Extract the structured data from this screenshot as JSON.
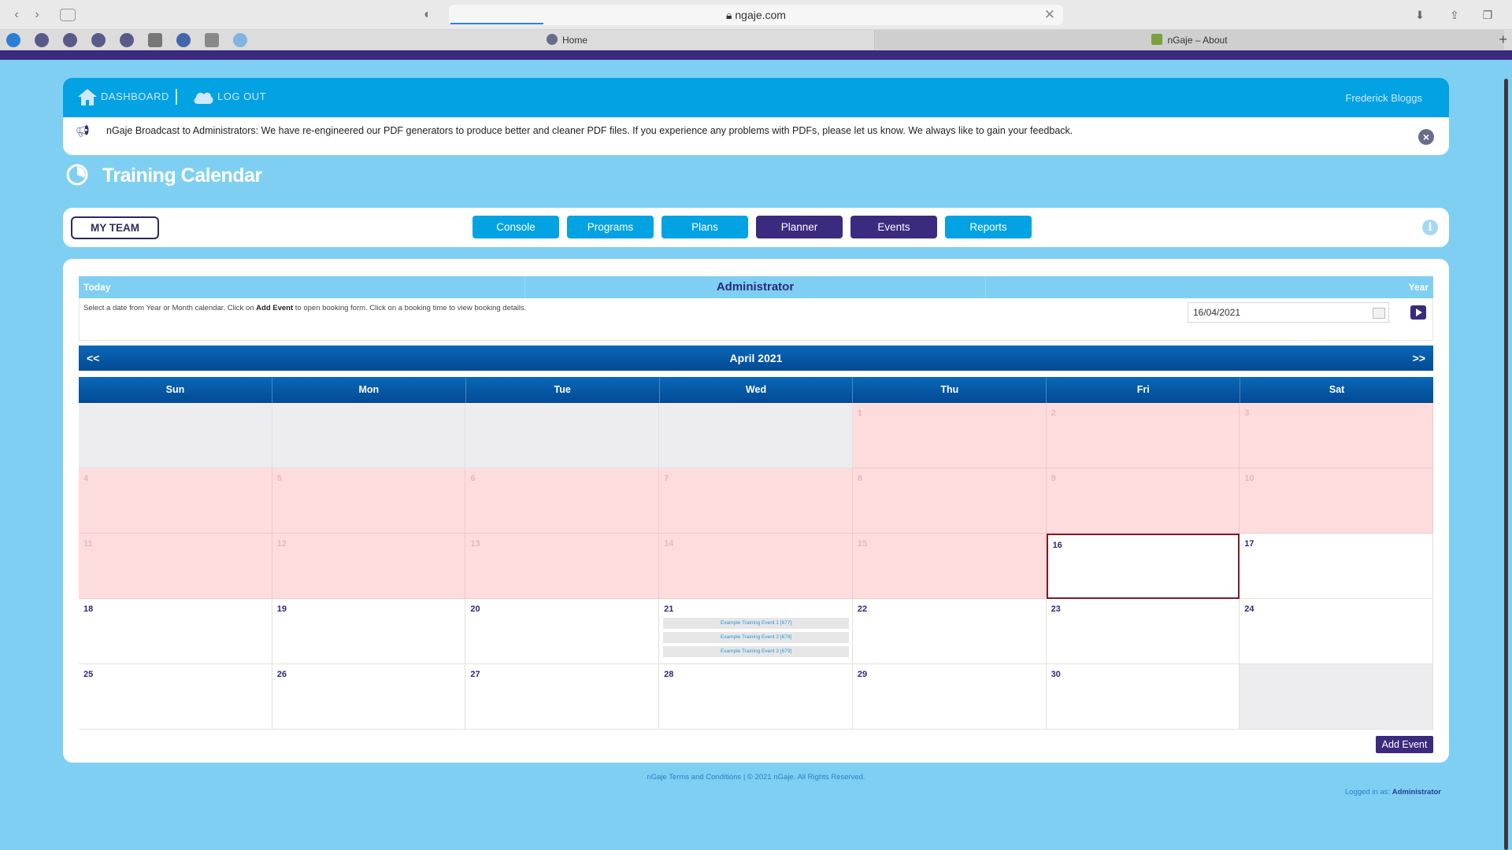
{
  "browser": {
    "url": "ngaje.com",
    "tabs": [
      {
        "label": "Home"
      },
      {
        "label": "nGaje – About"
      }
    ]
  },
  "header": {
    "dashboard_label": "DASHBOARD",
    "logout_label": "LOG OUT",
    "user_name": "Frederick Bloggs"
  },
  "broadcast": {
    "message": "nGaje Broadcast to Administrators: We have re-engineered our PDF generators to produce better and cleaner PDF files. If you experience any problems with PDFs, please let us know. We always like to gain your feedback."
  },
  "page": {
    "title": "Training Calendar"
  },
  "nav": {
    "my_team_label": "MY TEAM",
    "buttons": [
      {
        "label": "Console",
        "style": "blue"
      },
      {
        "label": "Programs",
        "style": "blue"
      },
      {
        "label": "Plans",
        "style": "blue"
      },
      {
        "label": "Planner",
        "style": "purple"
      },
      {
        "label": "Events",
        "style": "purple"
      },
      {
        "label": "Reports",
        "style": "blue"
      }
    ]
  },
  "calendar": {
    "today_label": "Today",
    "role_label": "Administrator",
    "year_label": "Year",
    "instructions_pre": "Select a date from Year or Month calendar. Click on ",
    "instructions_bold": "Add Event",
    "instructions_post": " to open booking form. Click on a booking time to view booking details.",
    "date_value": "16/04/2021",
    "prev_label": "<<",
    "next_label": ">>",
    "month_label": "April 2021",
    "day_names": [
      "Sun",
      "Mon",
      "Tue",
      "Wed",
      "Thu",
      "Fri",
      "Sat"
    ],
    "weeks": [
      [
        {
          "n": "",
          "s": "empty"
        },
        {
          "n": "",
          "s": "empty"
        },
        {
          "n": "",
          "s": "empty"
        },
        {
          "n": "",
          "s": "empty"
        },
        {
          "n": "1",
          "s": "past"
        },
        {
          "n": "2",
          "s": "past"
        },
        {
          "n": "3",
          "s": "past"
        }
      ],
      [
        {
          "n": "4",
          "s": "past"
        },
        {
          "n": "5",
          "s": "past"
        },
        {
          "n": "6",
          "s": "past"
        },
        {
          "n": "7",
          "s": "past"
        },
        {
          "n": "8",
          "s": "past"
        },
        {
          "n": "9",
          "s": "past"
        },
        {
          "n": "10",
          "s": "past"
        }
      ],
      [
        {
          "n": "11",
          "s": "past"
        },
        {
          "n": "12",
          "s": "past"
        },
        {
          "n": "13",
          "s": "past"
        },
        {
          "n": "14",
          "s": "past"
        },
        {
          "n": "15",
          "s": "past"
        },
        {
          "n": "16",
          "s": "today"
        },
        {
          "n": "17",
          "s": "normal"
        }
      ],
      [
        {
          "n": "18",
          "s": "normal"
        },
        {
          "n": "19",
          "s": "normal"
        },
        {
          "n": "20",
          "s": "normal"
        },
        {
          "n": "21",
          "s": "normal",
          "events": [
            "Example Training Event 1 [677]",
            "Example Training Event 2 [678]",
            "Example Training Event 3 [679]"
          ]
        },
        {
          "n": "22",
          "s": "normal"
        },
        {
          "n": "23",
          "s": "normal"
        },
        {
          "n": "24",
          "s": "normal"
        }
      ],
      [
        {
          "n": "25",
          "s": "normal"
        },
        {
          "n": "26",
          "s": "normal"
        },
        {
          "n": "27",
          "s": "normal"
        },
        {
          "n": "28",
          "s": "normal"
        },
        {
          "n": "29",
          "s": "normal"
        },
        {
          "n": "30",
          "s": "normal"
        },
        {
          "n": "",
          "s": "empty"
        }
      ]
    ],
    "add_event_label": "Add Event"
  },
  "footer": {
    "text": "nGaje Terms and Conditions  |  © 2021 nGaje. All Rights Reserved.",
    "logged_prefix": "Logged in as: ",
    "logged_user": "Administrator"
  },
  "colors": {
    "page_bg": "#7fcff3",
    "header_blue": "#03a2e3",
    "purple": "#3b2a7e",
    "past_day": "#fddcde"
  }
}
